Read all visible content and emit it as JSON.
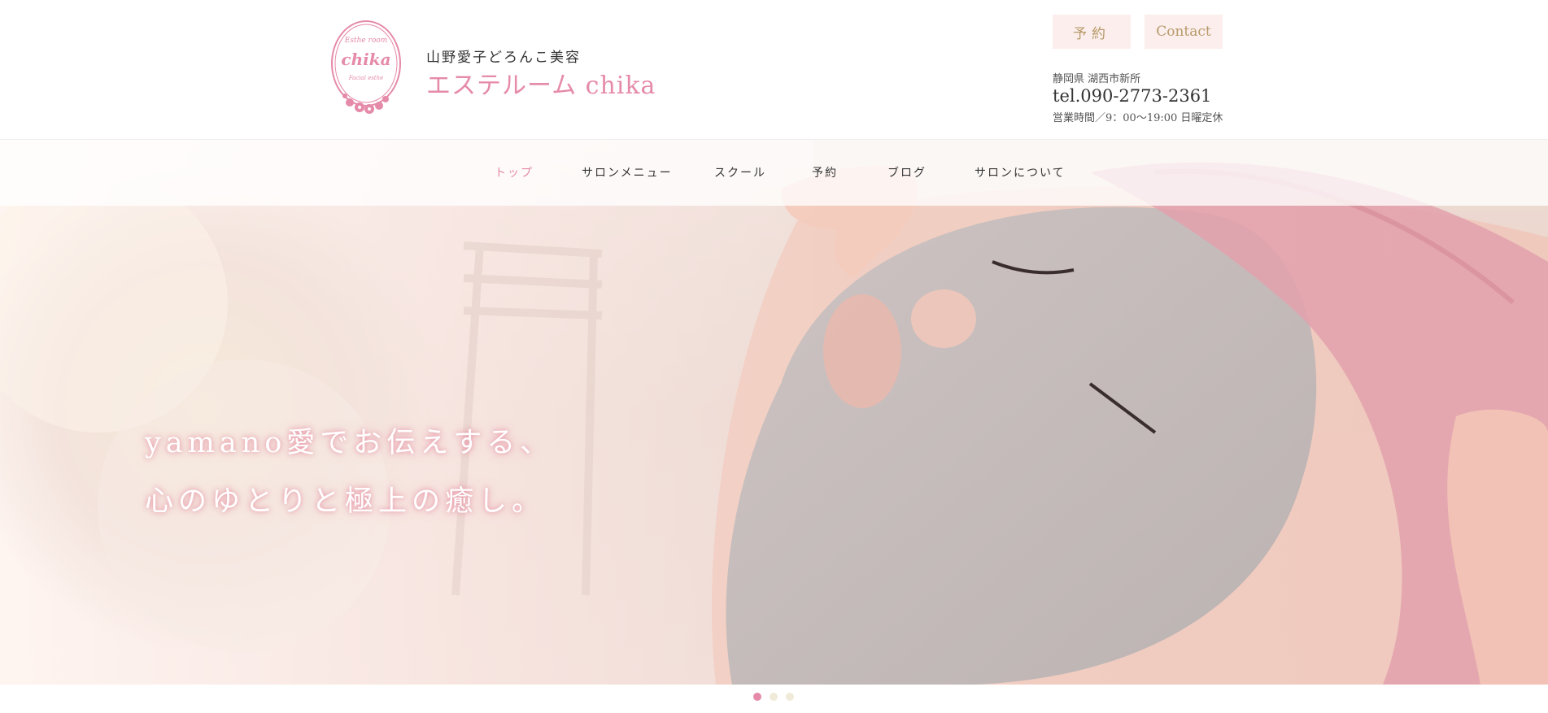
{
  "header": {
    "logo": {
      "top_text": "Esthe room",
      "name": "chika",
      "bottom_text": "Facial esthe"
    },
    "subtitle": "山野愛子どろんこ美容",
    "title": "エステルーム chika",
    "buttons": {
      "reserve": "予約",
      "contact": "Contact"
    },
    "address": "静岡県 湖西市新所",
    "tel": "tel.090-2773-2361",
    "hours": "営業時間／9：00〜19:00 日曜定休"
  },
  "nav": {
    "items": [
      {
        "label": "トップ",
        "active": true
      },
      {
        "label": "サロンメニュー",
        "active": false
      },
      {
        "label": "スクール",
        "active": false
      },
      {
        "label": "予約",
        "active": false
      },
      {
        "label": "ブログ",
        "active": false
      },
      {
        "label": "サロンについて",
        "active": false
      }
    ]
  },
  "hero": {
    "line1": "yamano愛でお伝えする、",
    "line2": "心のゆとりと極上の癒し。"
  },
  "slider": {
    "total": 3,
    "active_index": 0
  },
  "colors": {
    "accent_pink": "#e58aa8",
    "button_bg": "#fbeeec",
    "button_text": "#b89a6a",
    "dot_inactive": "#f0ead8"
  }
}
